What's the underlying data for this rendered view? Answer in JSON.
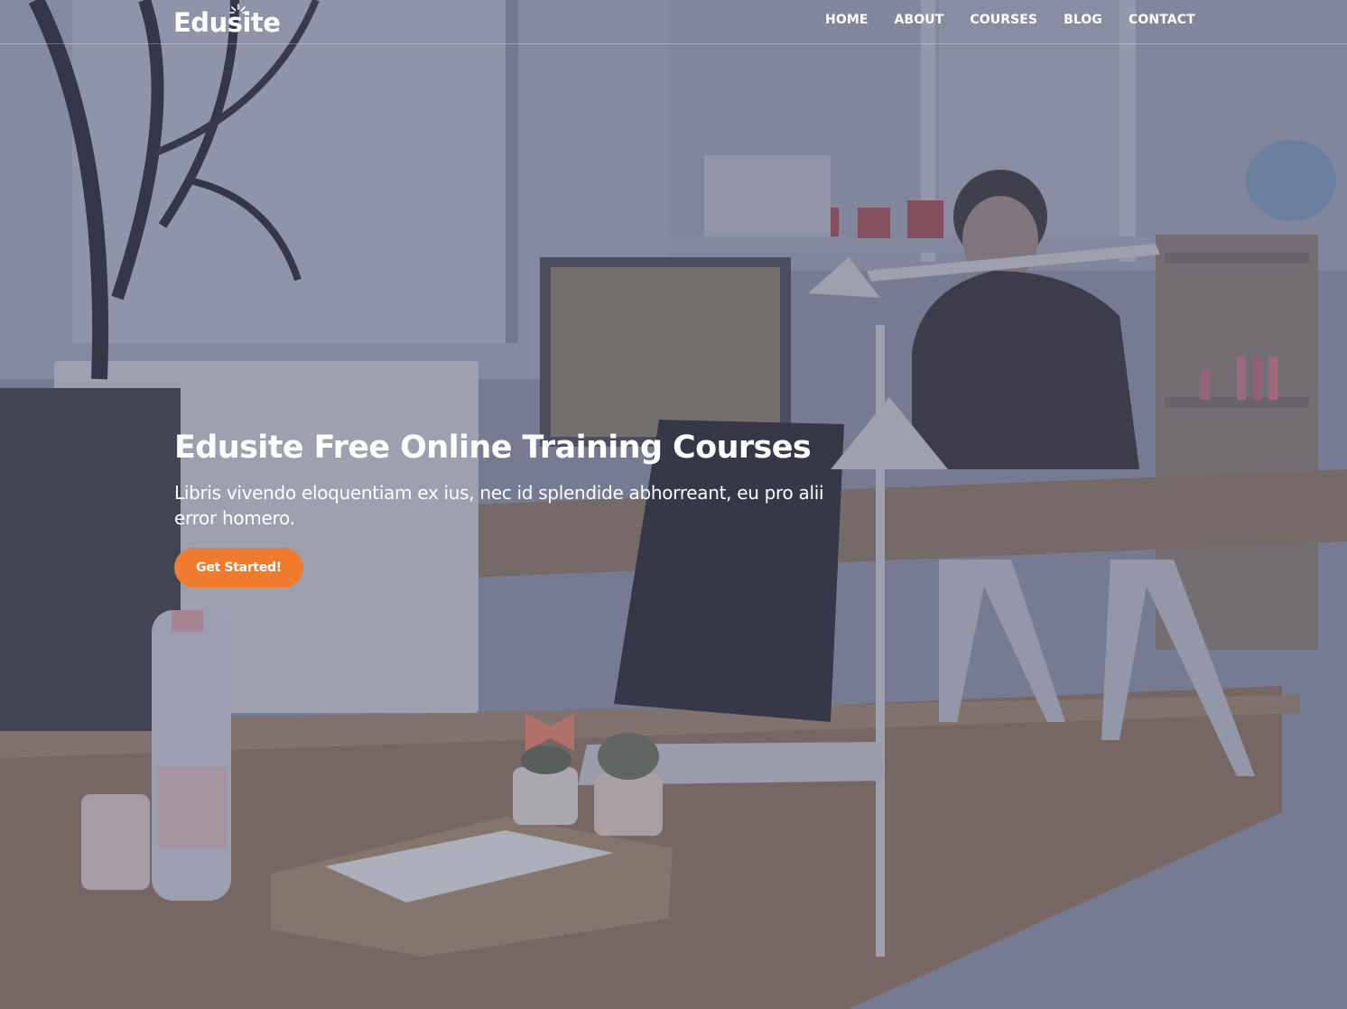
{
  "brand": {
    "name": "Edusite"
  },
  "nav": {
    "items": [
      {
        "label": "HOME"
      },
      {
        "label": "ABOUT"
      },
      {
        "label": "COURSES"
      },
      {
        "label": "BLOG"
      },
      {
        "label": "CONTACT"
      }
    ]
  },
  "hero": {
    "title": "Edusite Free Online Training Courses",
    "subtitle": "Libris vivendo eloquentiam ex ius, nec id splendide abhorreant, eu pro alii error homero.",
    "cta_label": "Get Started!",
    "background_image": "office-workspace-photo"
  },
  "colors": {
    "accent": "#f07b2f",
    "overlay": "#464c66",
    "text": "#ffffff"
  }
}
